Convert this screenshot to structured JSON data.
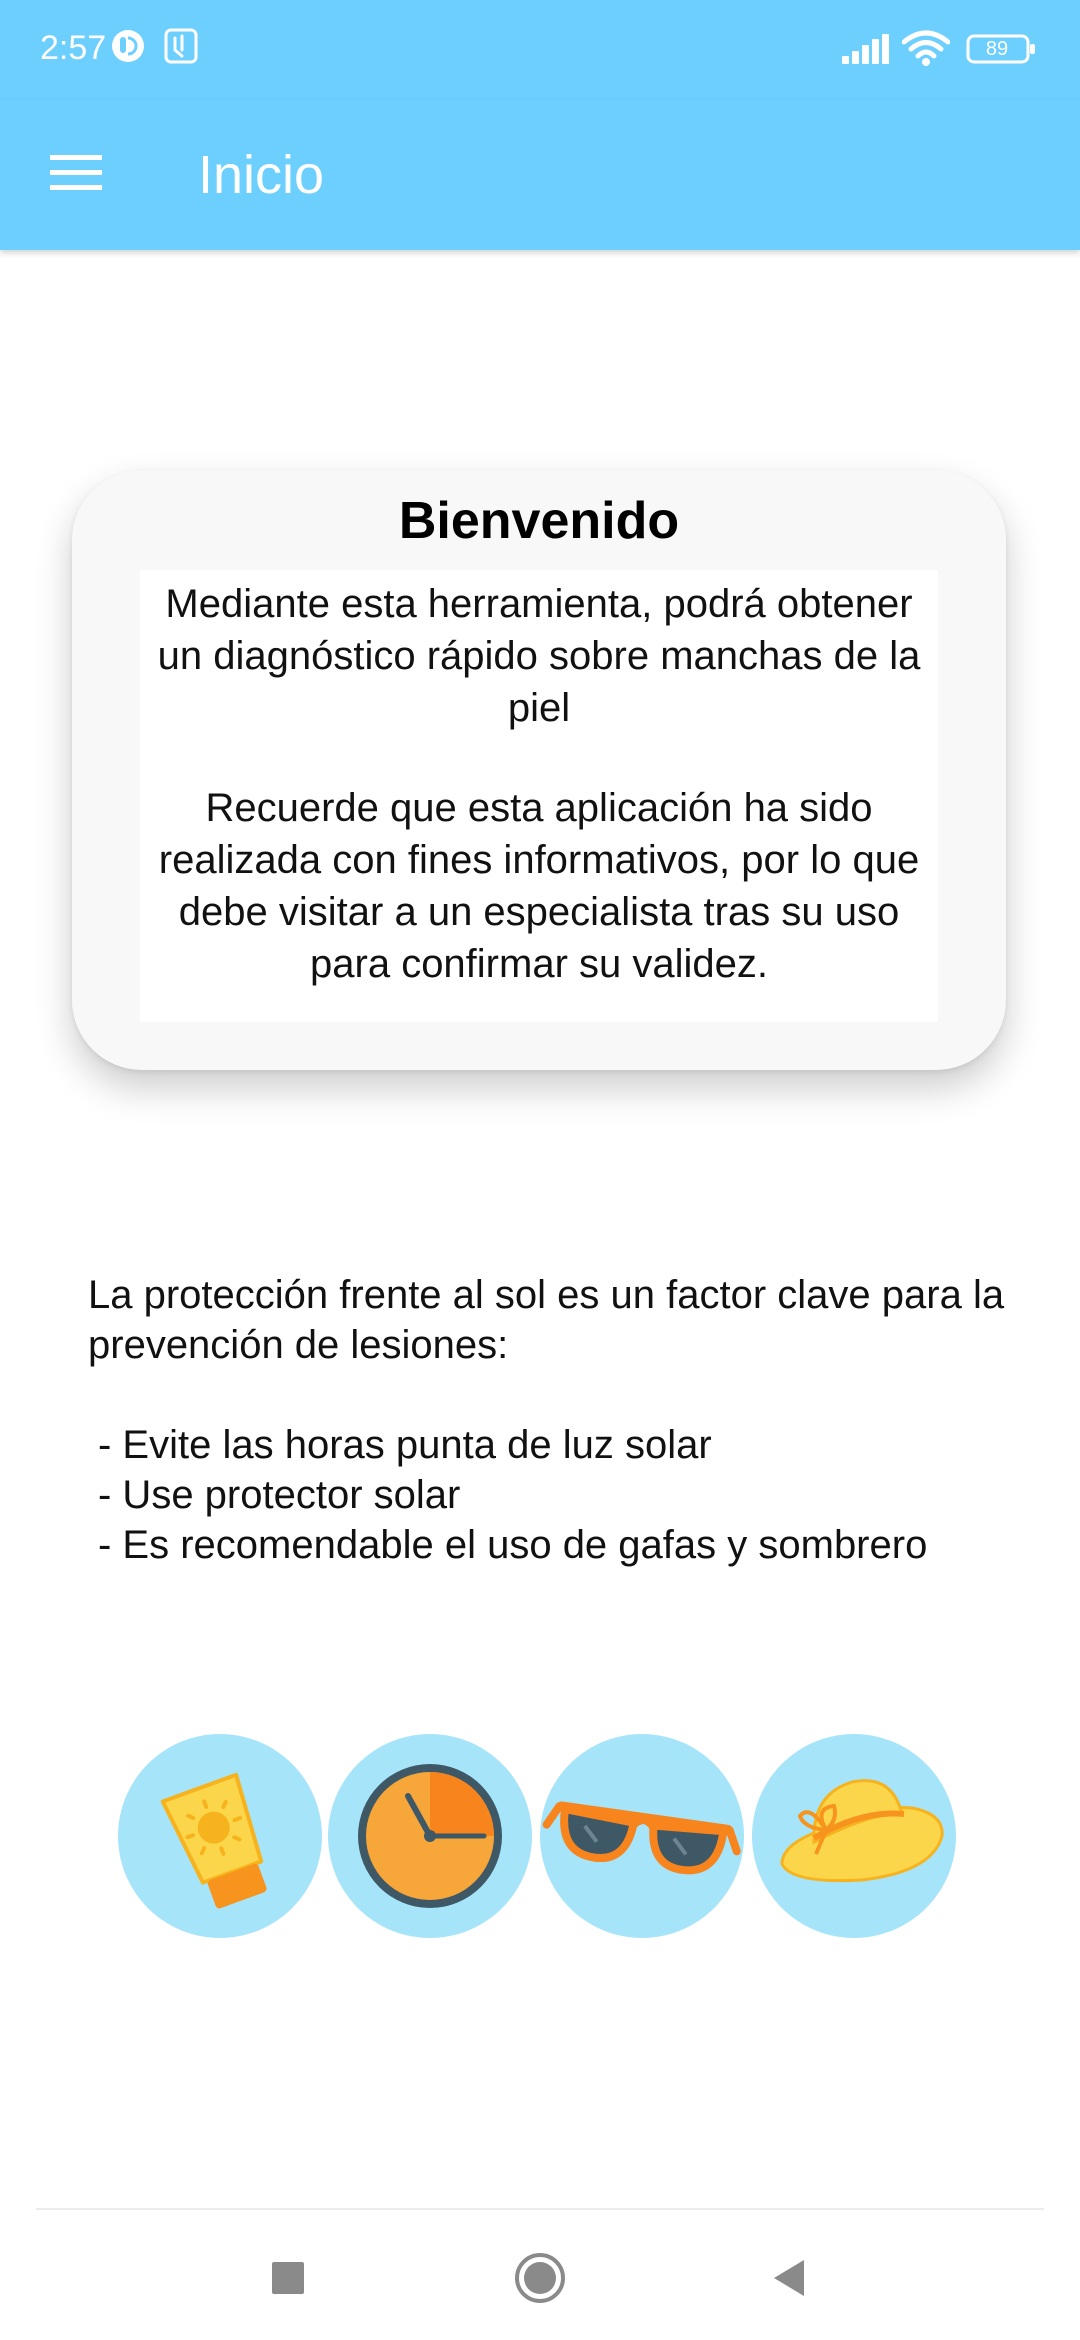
{
  "status_bar": {
    "time": "2:57",
    "battery": "89",
    "icons": [
      "notification-app-icon",
      "sim-app-icon",
      "signal-icon",
      "wifi-icon",
      "battery-icon"
    ]
  },
  "app_bar": {
    "title": "Inicio",
    "menu_icon": "hamburger-menu-icon"
  },
  "welcome_card": {
    "title": "Bienvenido",
    "paragraph_1": "Mediante esta herramienta, podrá obtener un diagnóstico rápido sobre manchas de la piel",
    "paragraph_2": "Recuerde que esta aplicación ha sido realizada con fines informativos, por lo que debe visitar a un especialista tras su uso para confirmar su validez."
  },
  "protection": {
    "intro": "La protección frente al sol es un factor clave para la prevención de lesiones:",
    "tips": [
      "- Evite las horas punta de luz solar",
      "- Use protector solar",
      "- Es recomendable el uso de gafas y sombrero"
    ]
  },
  "illustrations": [
    "sunscreen-icon",
    "clock-icon",
    "sunglasses-icon",
    "sun-hat-icon"
  ],
  "nav_bar": {
    "buttons": [
      "recents-square-icon",
      "home-circle-icon",
      "back-triangle-icon"
    ]
  },
  "colors": {
    "primary": "#6ccffe",
    "circle_bg": "#a6e4fa",
    "orange": "#f7941d",
    "yellow": "#fcd64a"
  }
}
